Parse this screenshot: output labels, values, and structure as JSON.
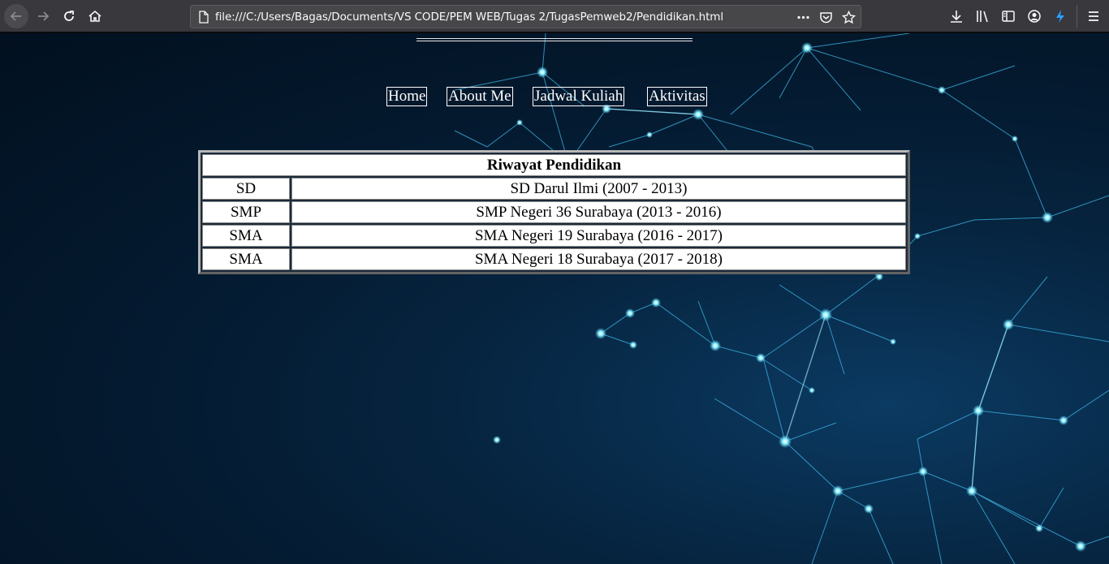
{
  "browser": {
    "url": "file:///C:/Users/Bagas/Documents/VS CODE/PEM WEB/Tugas 2/TugasPemweb2/Pendidikan.html",
    "icons": [
      "back-icon",
      "forward-icon",
      "reload-icon",
      "home-icon",
      "page-icon",
      "more-actions-icon",
      "pocket-icon",
      "bookmark-star-icon",
      "download-icon",
      "library-icon",
      "sidebar-icon",
      "account-icon",
      "extension-icon",
      "menu-icon"
    ]
  },
  "nav": {
    "items": [
      {
        "label": "Home"
      },
      {
        "label": "About Me"
      },
      {
        "label": "Jadwal Kuliah"
      },
      {
        "label": "Aktivitas"
      }
    ]
  },
  "table": {
    "heading": "Riwayat Pendidikan",
    "rows": [
      {
        "level": "SD",
        "school": "SD Darul Ilmi (2007 - 2013)"
      },
      {
        "level": "SMP",
        "school": "SMP Negeri 36 Surabaya (2013 - 2016)"
      },
      {
        "level": "SMA",
        "school": "SMA Negeri 19 Surabaya (2016 - 2017)"
      },
      {
        "level": "SMA",
        "school": "SMA Negeri 18 Surabaya (2017 - 2018)"
      }
    ]
  },
  "colors": {
    "chrome": "#38383d",
    "urlbar": "#474749",
    "background_dark": "#02101f",
    "network_glow": "#4fd6ff"
  }
}
